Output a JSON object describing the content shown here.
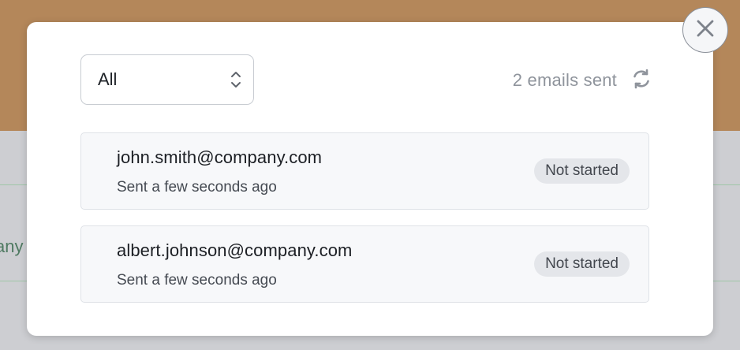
{
  "backdrop": {
    "fragment_text": "any"
  },
  "modal": {
    "filter": {
      "selected": "All"
    },
    "sent_count": "2 emails sent",
    "emails": [
      {
        "address": "john.smith@company.com",
        "time": "Sent a few seconds ago",
        "status": "Not started"
      },
      {
        "address": "albert.johnson@company.com",
        "time": "Sent a few seconds ago",
        "status": "Not started"
      }
    ]
  },
  "icons": {
    "close": "close-icon",
    "refresh": "refresh-icon",
    "select": "chevron-up-down-icon"
  },
  "colors": {
    "header_bg": "#b4875a",
    "backdrop": "#cdced2",
    "badge_bg": "#e4e6ea"
  }
}
